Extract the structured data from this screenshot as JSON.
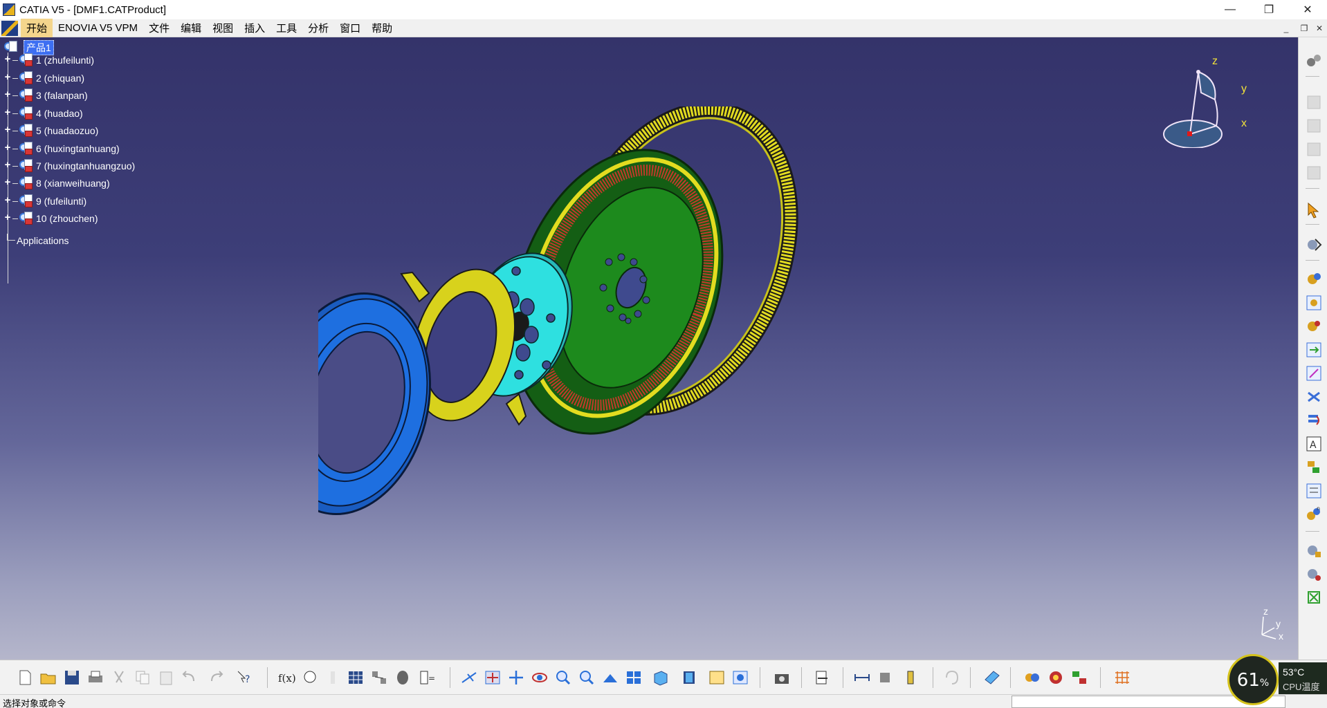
{
  "window": {
    "title": "CATIA V5 - [DMF1.CATProduct]",
    "minimize": "—",
    "maximize": "❐",
    "close": "✕"
  },
  "menu": {
    "items": [
      "开始",
      "ENOVIA V5 VPM",
      "文件",
      "编辑",
      "视图",
      "插入",
      "工具",
      "分析",
      "窗口",
      "帮助"
    ],
    "active": "开始",
    "mdi_minimize": "_",
    "mdi_restore": "❐",
    "mdi_close": "✕"
  },
  "tree": {
    "root": "产品1",
    "expander_symbol": "+",
    "items": [
      "1 (zhufeilunti)",
      "2 (chiquan)",
      "3 (falanpan)",
      "4 (huadao)",
      "5 (huadaozuo)",
      "6 (huxingtanhuang)",
      "7 (huxingtanhuangzuo)",
      "8 (xianweihuang)",
      "9 (fufeilunti)",
      "10 (zhouchen)"
    ],
    "applications": "Applications"
  },
  "compass": {
    "z": "z",
    "y": "y",
    "x": "x"
  },
  "mini_axis": {
    "z": "z",
    "y": "y",
    "x": "x"
  },
  "model_colors": {
    "cover": "#1e6fe0",
    "flange": "#d8d21c",
    "hub": "#2ee0e0",
    "flywheel": "#1d8a1d",
    "springs": "#c23a2a",
    "ring_gear": "#e3dc20"
  },
  "status": {
    "text": "选择对象或命令"
  },
  "cpu": {
    "percent": "61",
    "percent_sign": "%",
    "temp": "53°C",
    "label": "CPU温度"
  }
}
